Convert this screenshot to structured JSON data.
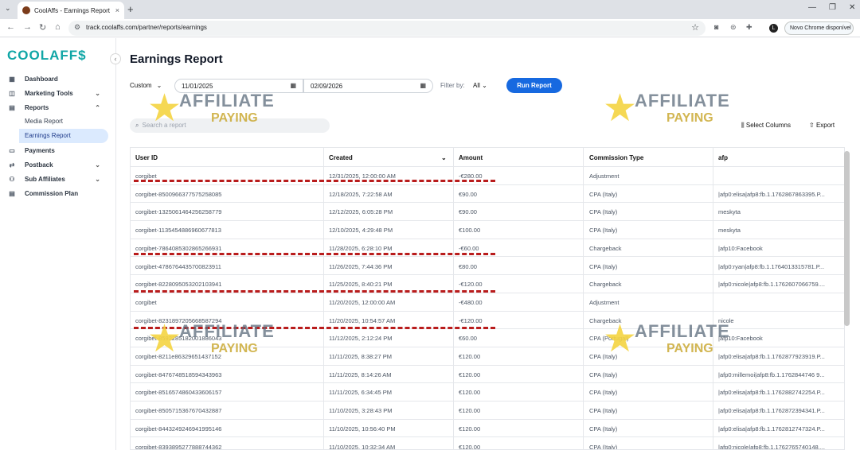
{
  "browser": {
    "tab_title": "CoolAffs - Earnings Report",
    "tab_close": "×",
    "new_tab": "+",
    "url": "track.coolaffs.com/partner/reports/earnings",
    "profile_initial": "L",
    "update_label": "Novo Chrome disponível"
  },
  "sidebar": {
    "logo": "COOLAFF$",
    "collapse": "‹",
    "items": [
      {
        "label": "Dashboard",
        "icon": "dashboard-icon",
        "glyph": "▦"
      },
      {
        "label": "Marketing Tools",
        "icon": "marketing-icon",
        "glyph": "◫",
        "chev": "⌄"
      },
      {
        "label": "Reports",
        "icon": "reports-icon",
        "glyph": "▤",
        "chev": "⌃"
      },
      {
        "label": "Payments",
        "icon": "payments-icon",
        "glyph": "▭"
      },
      {
        "label": "Postback",
        "icon": "postback-icon",
        "glyph": "⇄",
        "chev": "⌄"
      },
      {
        "label": "Sub Affiliates",
        "icon": "sub-affiliates-icon",
        "glyph": "⚇",
        "chev": "⌄"
      },
      {
        "label": "Commission Plan",
        "icon": "commission-icon",
        "glyph": "▤"
      }
    ],
    "sub_items": [
      "Media Report",
      "Earnings Report"
    ]
  },
  "page": {
    "title": "Earnings Report",
    "range_preset": "Custom",
    "date_from": "11/01/2025",
    "date_to": "02/09/2026",
    "filter_label": "Filter by:",
    "filter_value": "All",
    "run_button": "Run Report",
    "search_placeholder": "Search a report",
    "select_columns": "Select Columns",
    "export": "Export"
  },
  "table": {
    "headers": [
      "User ID",
      "Created",
      "Amount",
      "Commission Type",
      "afp"
    ],
    "sort_icon": "⌄",
    "rows": [
      [
        "corgibet",
        "12/31/2025, 12:00:00 AM",
        "-€280.00",
        "Adjustment",
        ""
      ],
      [
        "corgibet-8500966377575258085",
        "12/18/2025, 7:22:58 AM",
        "€90.00",
        "CPA (Italy)",
        "|afp0:elisa|afp8:fb.1.1762867863395.P..."
      ],
      [
        "corgibet-1325061464256258779",
        "12/12/2025, 6:05:28 PM",
        "€90.00",
        "CPA (Italy)",
        "meskyta"
      ],
      [
        "corgibet-1135454886960677813",
        "12/10/2025, 4:29:48 PM",
        "€100.00",
        "CPA (Italy)",
        "meskyta"
      ],
      [
        "corgibet-7864085302865266931",
        "11/28/2025, 6:28:10 PM",
        "-€60.00",
        "Chargeback",
        "|afp10:Facebook"
      ],
      [
        "corgibet-4786764435700823911",
        "11/26/2025, 7:44:36 PM",
        "€80.00",
        "CPA (Italy)",
        "|afp0:ryan|afp8:fb.1.1764013315781.P..."
      ],
      [
        "corgibet-8228095053202103941",
        "11/25/2025, 8:40:21 PM",
        "-€120.00",
        "Chargeback",
        "|afp0:nicole|afp8:fb.1.1762607066759...."
      ],
      [
        "corgibet",
        "11/20/2025, 12:00:00 AM",
        "-€480.00",
        "Adjustment",
        ""
      ],
      [
        "corgibet-8231897205668587294",
        "11/20/2025, 10:54:57 AM",
        "-€120.00",
        "Chargeback",
        "nicole"
      ],
      [
        "corgibet-8592285182001886043",
        "11/12/2025, 2:12:24 PM",
        "€60.00",
        "CPA (Portugal)",
        "|afp10:Facebook"
      ],
      [
        "corgibet-8211e86329651437152",
        "11/11/2025, 8:38:27 PM",
        "€120.00",
        "CPA (Italy)",
        "|afp0:elisa|afp8:fb.1.1762877923919.P..."
      ],
      [
        "corgibet-8476748518594343963",
        "11/11/2025, 8:14:26 AM",
        "€120.00",
        "CPA (Italy)",
        "|afp0:millemoi|afp8:fb.1.1762844746 9..."
      ],
      [
        "corgibet-8516574860433606157",
        "11/11/2025, 6:34:45 PM",
        "€120.00",
        "CPA (Italy)",
        "|afp0:elisa|afp8:fb.1.1762882742254.P..."
      ],
      [
        "corgibet-8505715367670432887",
        "11/10/2025, 3:28:43 PM",
        "€120.00",
        "CPA (Italy)",
        "|afp0:elisa|afp8:fb.1.1762872394341.P..."
      ],
      [
        "corgibet-8443249246941995146",
        "11/10/2025, 10:56:40 PM",
        "€120.00",
        "CPA (Italy)",
        "|afp0:elisa|afp8:fb.1.1762812747324.P..."
      ],
      [
        "corgibet-8393895277888744362",
        "11/10/2025, 10:32:34 AM",
        "€120.00",
        "CPA (Italy)",
        "|afp0:nicole|afp8:fb.1.1762765740148...."
      ]
    ]
  },
  "watermark": {
    "line1": "AFFILIATE",
    "line2": "PAYING"
  },
  "colors": {
    "accent": "#1769e0",
    "brand": "#10a6a6",
    "annotation": "#b91c1c"
  }
}
